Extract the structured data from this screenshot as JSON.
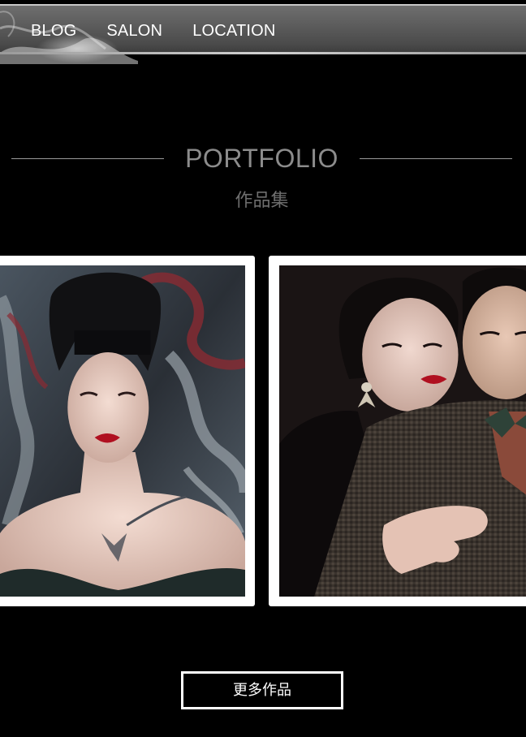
{
  "nav": {
    "items": [
      {
        "label": "BLOG"
      },
      {
        "label": "SALON"
      },
      {
        "label": "LOCATION"
      }
    ]
  },
  "portfolio": {
    "title": "PORTFOLIO",
    "subtitle": "作品集"
  },
  "gallery": {
    "items": [
      {
        "alt_icon": "portrait-photo"
      },
      {
        "alt_icon": "couple-portrait-photo"
      }
    ]
  },
  "more_button": {
    "label": "更多作品"
  },
  "colors": {
    "background": "#000000",
    "nav_bar": "#5a5a5a",
    "title_gray": "#8c8c8c",
    "subtitle_gray": "#6e6e6e",
    "button_border": "#ffffff"
  }
}
